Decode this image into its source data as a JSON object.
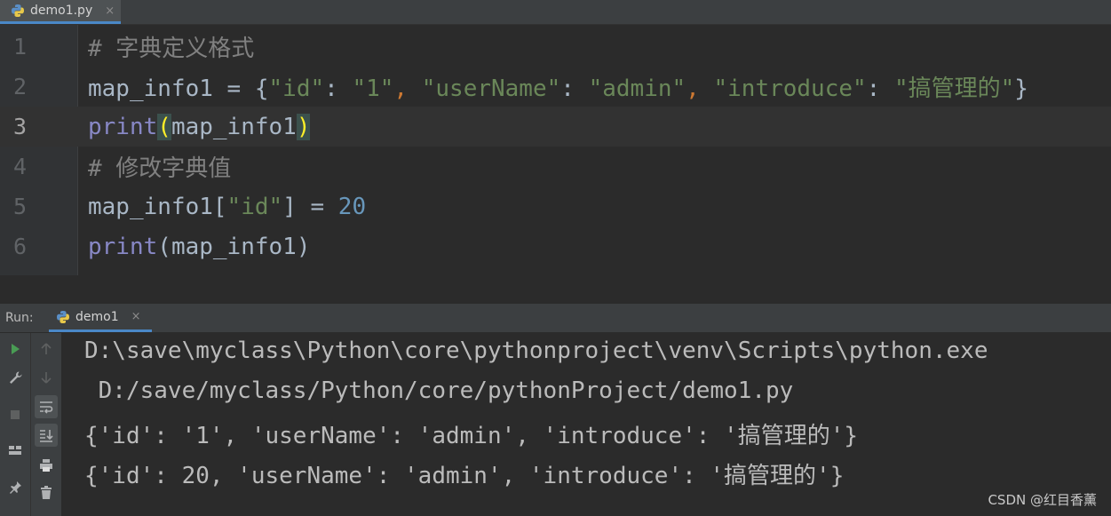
{
  "tab": {
    "filename": "demo1.py",
    "close": "×"
  },
  "editor": {
    "lines": [
      {
        "num": "1",
        "comment": "# 字典定义格式"
      },
      {
        "num": "2",
        "var": "map_info1",
        "eq": " = ",
        "ob": "{",
        "k1": "\"id\"",
        "c1": ": ",
        "v1": "\"1\"",
        "s1": ", ",
        "k2": "\"userName\"",
        "c2": ": ",
        "v2": "\"admin\"",
        "s2": ", ",
        "k3": "\"introduce\"",
        "c3": ": ",
        "v3": "\"搞管理的\"",
        "cb": "}"
      },
      {
        "num": "3",
        "fn": "print",
        "op": "(",
        "arg": "map_info1",
        "cp": ")"
      },
      {
        "num": "4",
        "comment": "# 修改字典值"
      },
      {
        "num": "5",
        "var": "map_info1",
        "ob": "[",
        "key": "\"id\"",
        "cb": "]",
        "eq": " = ",
        "val": "20"
      },
      {
        "num": "6",
        "fn": "print",
        "op": "(",
        "arg": "map_info1",
        "cp": ")"
      }
    ]
  },
  "run": {
    "label": "Run:",
    "tab_name": "demo1",
    "close": "×",
    "output": [
      "D:\\save\\myclass\\Python\\core\\pythonproject\\venv\\Scripts\\python.exe",
      " D:/save/myclass/Python/core/pythonProject/demo1.py",
      "{'id': '1', 'userName': 'admin', 'introduce': '搞管理的'}",
      "{'id': 20, 'userName': 'admin', 'introduce': '搞管理的'}"
    ]
  },
  "icons": {
    "col1": [
      "run-icon",
      "wrench-icon",
      "stop-icon",
      "layout-icon",
      "pin-icon"
    ],
    "col2": [
      "up-arrow-icon",
      "down-arrow-icon",
      "soft-wrap-icon",
      "scroll-to-end-icon",
      "print-icon",
      "trash-icon"
    ]
  },
  "watermark": "CSDN @红目香薰",
  "colors": {
    "accent": "#4a88c7",
    "run_green": "#499c54",
    "string": "#6a8759",
    "number": "#6897bb",
    "builtin": "#8888c6",
    "comment": "#808080"
  }
}
